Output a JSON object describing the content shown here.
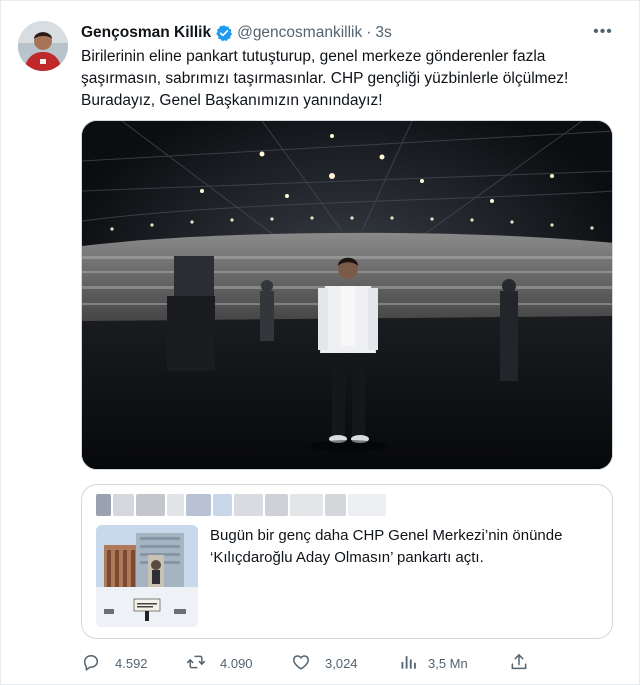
{
  "tweet": {
    "author_name": "Gençosman Killik",
    "handle": "@gencosmankillik",
    "separator": "·",
    "time": "3s",
    "more_label": "•••",
    "text_lines": [
      "Birilerinin eline pankart tutuşturup, genel merkeze gönderenler fazla",
      "şaşırmasın, sabrımızı taşırmasınlar. CHP gençliği yüzbinlerle ölçülmez!",
      "Buradayız, Genel Başkanımızın yanındayız!"
    ]
  },
  "quoted_tweet": {
    "text_lines": [
      "Bugün bir genç daha CHP Genel Merkezi’nin önünde",
      "‘Kılıçdaroğlu Aday Olmasın’ pankartı açtı."
    ]
  },
  "actions": {
    "replies": "4.592",
    "retweets": "4.090",
    "likes": "3,024",
    "views": "3,5 Mn"
  },
  "colors": {
    "text": "#0f1419",
    "secondary": "#536471",
    "border": "#cfd9de",
    "verified": "#1d9bf0"
  },
  "icons": [
    "verified-badge-icon",
    "more-icon",
    "reply-icon",
    "retweet-icon",
    "like-icon",
    "views-icon",
    "share-icon"
  ]
}
